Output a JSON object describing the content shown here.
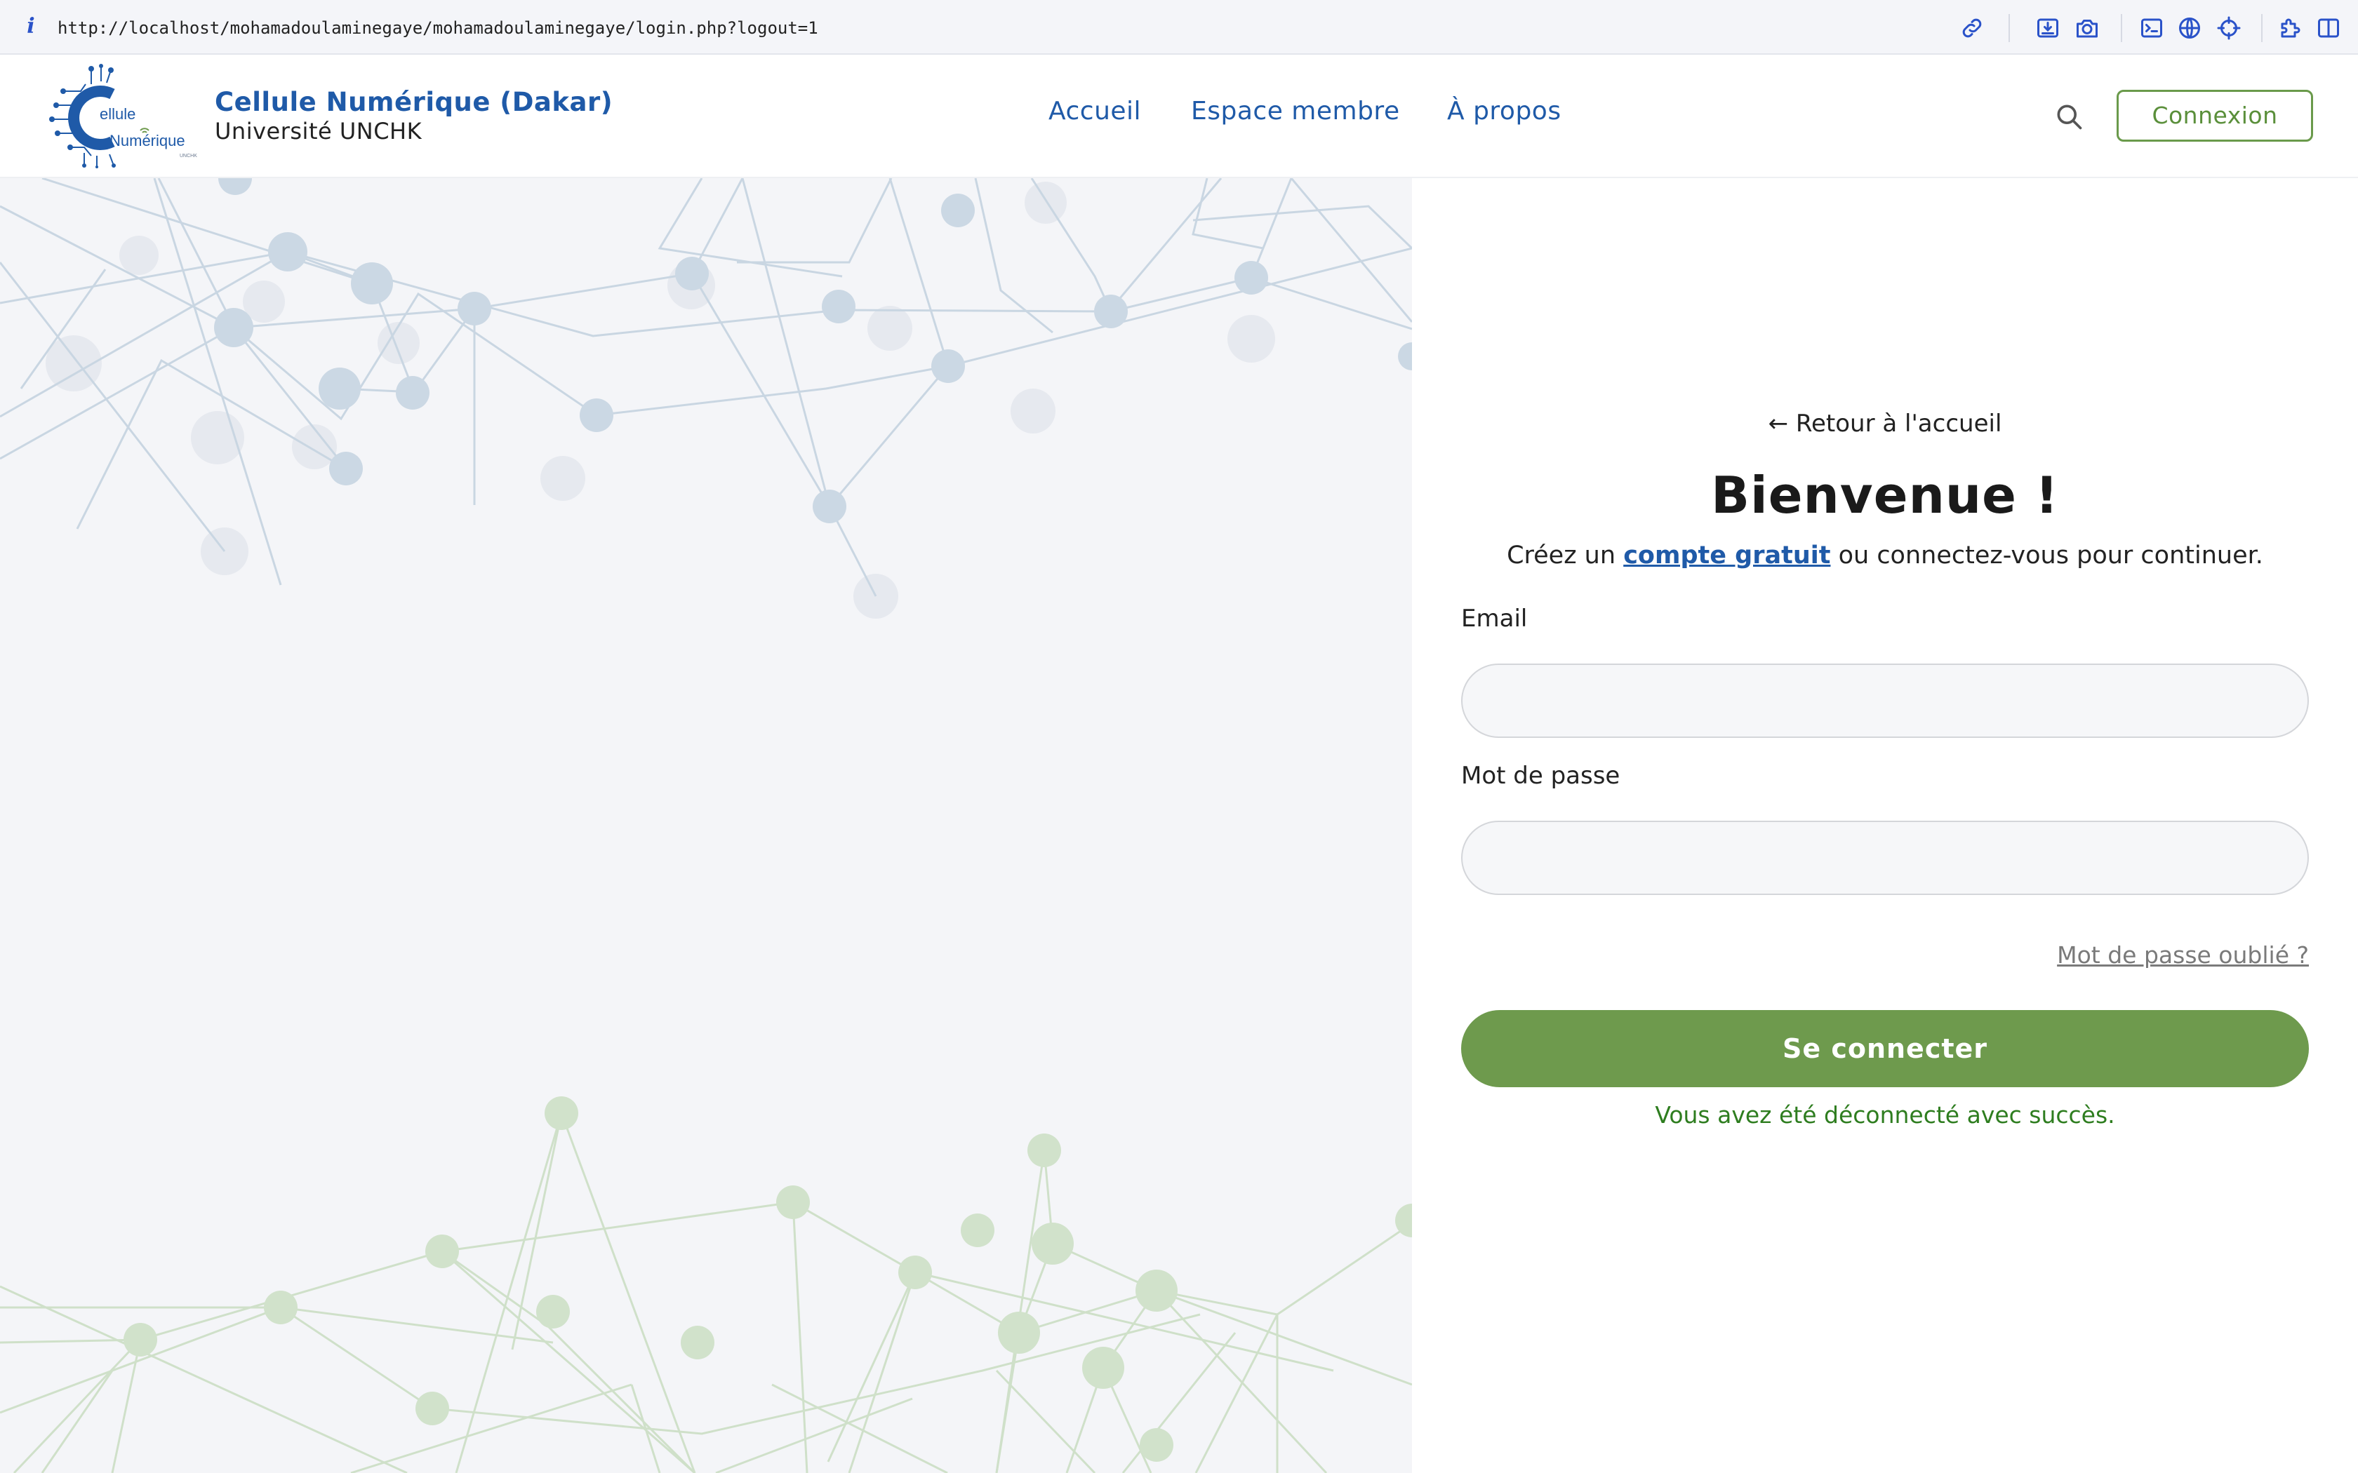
{
  "browser": {
    "url": "http://localhost/mohamadoulaminegaye/mohamadoulaminegaye/login.php?logout=1",
    "icons": [
      "info-icon",
      "link-icon",
      "download-icon",
      "camera-icon",
      "terminal-icon",
      "globe-icon",
      "crosshair-icon",
      "extensions-icon",
      "sidebar-icon"
    ]
  },
  "header": {
    "logo_text_top": "ellule",
    "logo_text_bottom": "Numérique",
    "logo_small": "UNCHK",
    "brand_title": "Cellule Numérique (Dakar)",
    "brand_subtitle": "Université UNCHK",
    "nav": [
      "Accueil",
      "Espace membre",
      "À propos"
    ],
    "connexion_label": "Connexion"
  },
  "login": {
    "back_link": "← Retour à l'accueil",
    "title": "Bienvenue !",
    "intro_before": "Créez un ",
    "intro_link": "compte gratuit",
    "intro_after": " ou connectez-vous pour continuer.",
    "email_label": "Email",
    "email_value": "",
    "password_label": "Mot de passe",
    "password_value": "",
    "forgot_label": "Mot de passe oublié ?",
    "submit_label": "Se connecter",
    "success_message": "Vous avez été déconnecté avec succès."
  },
  "colors": {
    "brand_blue": "#1f5aa8",
    "accent_green": "#6e9a4d",
    "success_green": "#2e7d1f",
    "network_blue": "#c9d6e2",
    "network_green": "#cfe0c9"
  }
}
